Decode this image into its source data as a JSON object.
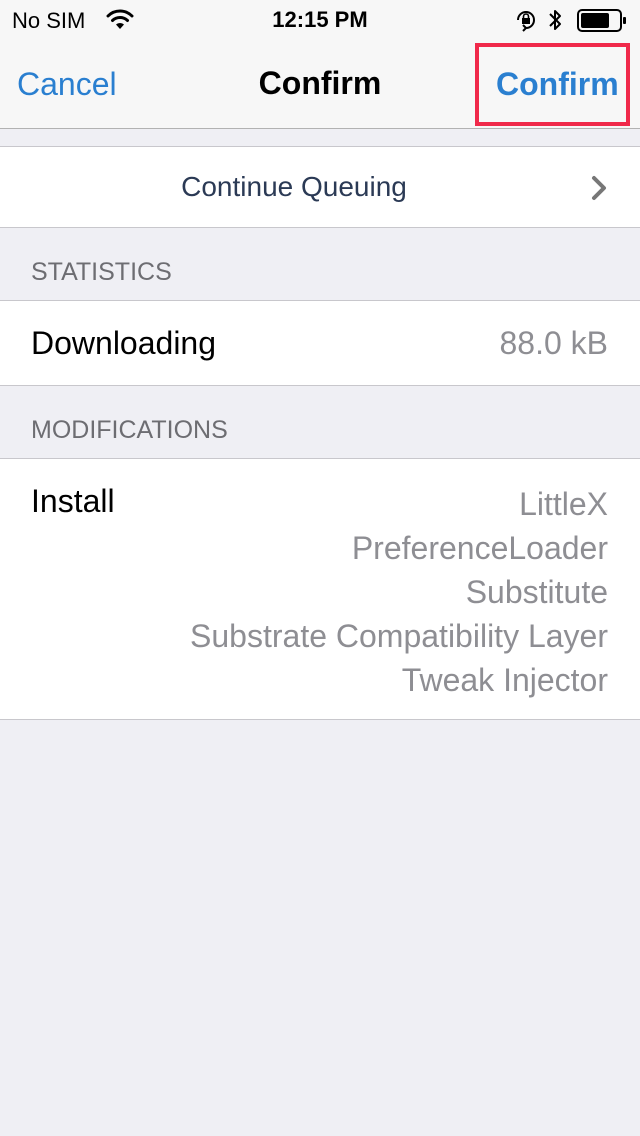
{
  "status_bar": {
    "carrier": "No SIM",
    "time": "12:15 PM",
    "icons": [
      "wifi-icon",
      "orientation-lock-icon",
      "bluetooth-icon",
      "battery-icon"
    ],
    "battery_level": 0.75
  },
  "nav": {
    "cancel_label": "Cancel",
    "title": "Confirm",
    "confirm_label": "Confirm",
    "highlight_color": "#f0294a",
    "accent_color": "#2a7fd0"
  },
  "queue": {
    "label": "Continue Queuing",
    "icon": "chevron-right-icon"
  },
  "statistics": {
    "header": "STATISTICS",
    "rows": [
      {
        "label": "Downloading",
        "value": "88.0 kB"
      }
    ]
  },
  "modifications": {
    "header": "MODIFICATIONS",
    "action": "Install",
    "packages": [
      "LittleX",
      "PreferenceLoader",
      "Substitute",
      "Substrate Compatibility Layer",
      "Tweak Injector"
    ]
  }
}
